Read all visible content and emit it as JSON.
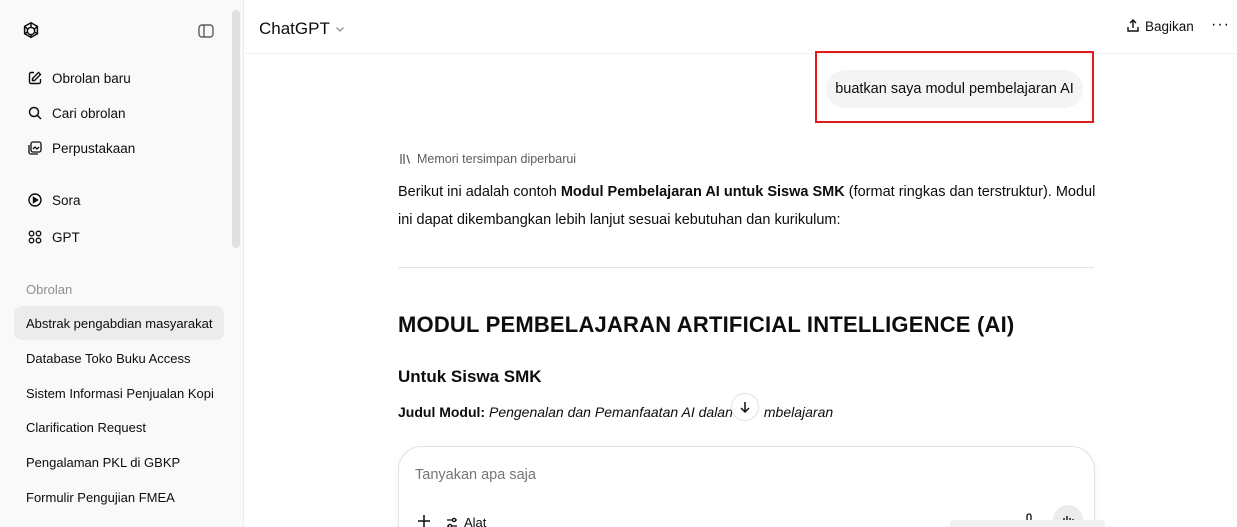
{
  "sidebar": {
    "logo_icon": "openai-logo-icon",
    "toggle_icon": "sidebar-toggle-icon",
    "nav": [
      {
        "label": "Obrolan baru",
        "icon": "edit-icon"
      },
      {
        "label": "Cari obrolan",
        "icon": "search-icon"
      },
      {
        "label": "Perpustakaan",
        "icon": "library-icon"
      },
      {
        "label": "Sora",
        "icon": "play-circle-icon"
      },
      {
        "label": "GPT",
        "icon": "grid-icon"
      }
    ],
    "section_title": "Obrolan",
    "chats": [
      {
        "label": "Abstrak pengabdian masyarakat",
        "active": true
      },
      {
        "label": "Database Toko Buku Access"
      },
      {
        "label": "Sistem Informasi Penjualan Kopi"
      },
      {
        "label": "Clarification Request"
      },
      {
        "label": "Pengalaman PKL di GBKP"
      },
      {
        "label": "Formulir Pengujian FMEA"
      }
    ]
  },
  "header": {
    "model": "ChatGPT",
    "share_label": "Bagikan",
    "more_label": "···"
  },
  "conversation": {
    "user_message": "buatkan saya modul pembelajaran AI",
    "memory_note": "Memori tersimpan diperbarui",
    "intro_pre": "Berikut ini adalah contoh ",
    "intro_bold": "Modul Pembelajaran AI untuk Siswa SMK",
    "intro_post": " (format ringkas dan terstruktur). Modul ini dapat dikembangkan lebih lanjut sesuai kebutuhan dan kurikulum:",
    "heading": "MODUL PEMBELAJARAN ARTIFICIAL INTELLIGENCE (AI)",
    "subheading": "Untuk Siswa SMK",
    "module_label": "Judul Modul:",
    "module_title_part1": "Pengenalan dan Pemanfaatan AI dalan",
    "module_title_part2": "mbelajaran"
  },
  "composer": {
    "placeholder": "Tanyakan apa saja",
    "tools_label": "Alat"
  },
  "colors": {
    "highlight_box": "#e11b1b",
    "sidebar_bg": "#f9f9f9",
    "bubble_bg": "#f4f4f4"
  }
}
